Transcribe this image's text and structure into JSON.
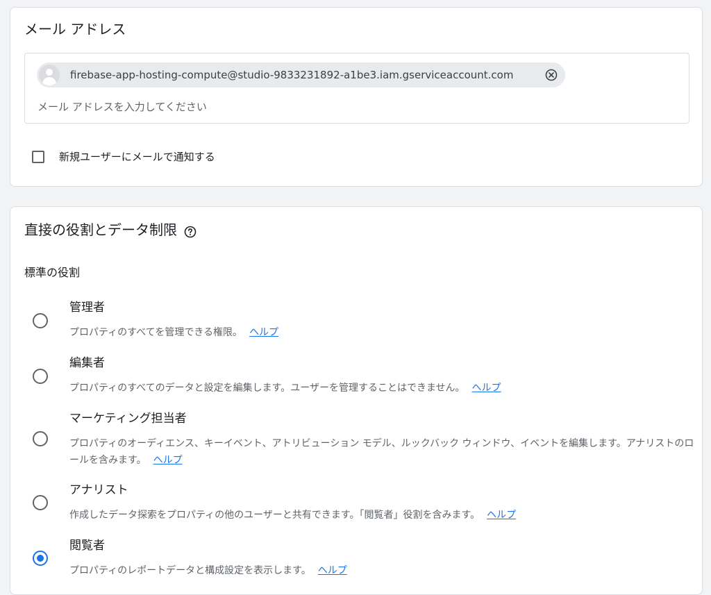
{
  "email_section": {
    "title": "メール アドレス",
    "chip_email": "firebase-app-hosting-compute@studio-9833231892-a1be3.iam.gserviceaccount.com",
    "input_placeholder": "メール アドレスを入力してください",
    "notify_label": "新規ユーザーにメールで通知する",
    "notify_checked": false
  },
  "roles_section": {
    "title": "直接の役割とデータ制限",
    "standard_roles_label": "標準の役割",
    "help_text": "ヘルプ",
    "roles": [
      {
        "name": "管理者",
        "description": "プロパティのすべてを管理できる権限。",
        "selected": false
      },
      {
        "name": "編集者",
        "description": "プロパティのすべてのデータと設定を編集します。ユーザーを管理することはできません。",
        "selected": false
      },
      {
        "name": "マーケティング担当者",
        "description": "プロパティのオーディエンス、キーイベント、アトリビューション モデル、ルックバック ウィンドウ、イベントを編集します。アナリストのロールを含みます。",
        "selected": false
      },
      {
        "name": "アナリスト",
        "description": "作成したデータ探索をプロパティの他のユーザーと共有できます。「閲覧者」役割を含みます。",
        "selected": false
      },
      {
        "name": "閲覧者",
        "description": "プロパティのレポートデータと構成設定を表示します。",
        "selected": true
      }
    ]
  },
  "colors": {
    "accent": "#1a73e8",
    "text_primary": "#202124",
    "text_secondary": "#5f6368",
    "border": "#dadce0",
    "page_background": "#f1f3f4"
  },
  "icons": {
    "avatar": "account-circle-icon",
    "chip_remove": "cancel-circle-icon",
    "help": "help-circle-icon"
  }
}
